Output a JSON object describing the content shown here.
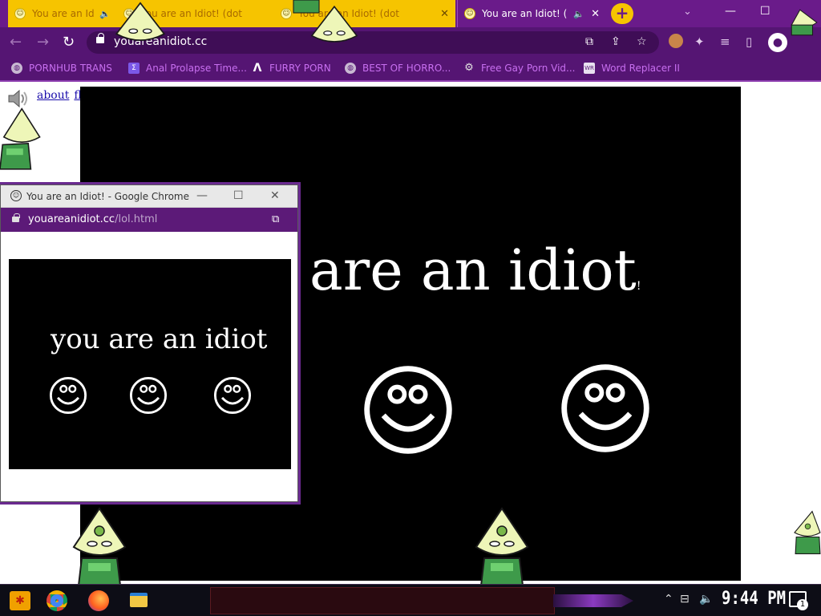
{
  "browser": {
    "tabs": [
      {
        "title": "You are an Idiot!",
        "style": "yellow",
        "audio": true,
        "favicon": "smiley-icon"
      },
      {
        "title": "You are an Idiot! (dot",
        "style": "yellow",
        "audio": false,
        "favicon": "smiley-icon"
      },
      {
        "title": "You are an Idiot! (dot",
        "style": "yellow",
        "audio": false,
        "favicon": "smiley-icon"
      },
      {
        "title": "You are an Idiot! (",
        "style": "active",
        "audio": true,
        "favicon": "smiley-icon"
      }
    ],
    "close_glyph": "✕",
    "audio_glyph": "🔈",
    "new_tab_glyph": "+",
    "tab_menu_glyph": "⌄",
    "url": "youareanidiot.cc",
    "bookmarks": [
      {
        "label": "PORNHUB TRANS",
        "icon": "globe-icon"
      },
      {
        "label": "Anal Prolapse Time...",
        "icon": "bracket-icon"
      },
      {
        "label": "FURRY PORN",
        "icon": "arrow-logo-icon"
      },
      {
        "label": "BEST OF HORRO...",
        "icon": "globe-icon"
      },
      {
        "label": "Free Gay Porn Vid...",
        "icon": "gear-icon"
      },
      {
        "label": "Word Replacer II",
        "icon": "wr-icon"
      }
    ]
  },
  "page": {
    "links": [
      "about",
      "flash"
    ],
    "headline": "are an idiot",
    "headline_trailing": "!",
    "smileys_count": 2
  },
  "popup": {
    "title": "You are an Idiot! - Google Chrome",
    "url_domain": "youareanidiot.cc",
    "url_path": "/lol.html",
    "headline": "you are an idiot",
    "smileys_count": 3
  },
  "taskbar": {
    "time": "9:44 PM",
    "notification_count": "1"
  },
  "colors": {
    "chrome_purple": "#6a1b8a",
    "tab_yellow": "#f6c400",
    "bookmark_text": "#c86ff0",
    "stage": "#000000",
    "peridot_skin": "#eef6b8",
    "peridot_suit": "#3e9a4a"
  }
}
